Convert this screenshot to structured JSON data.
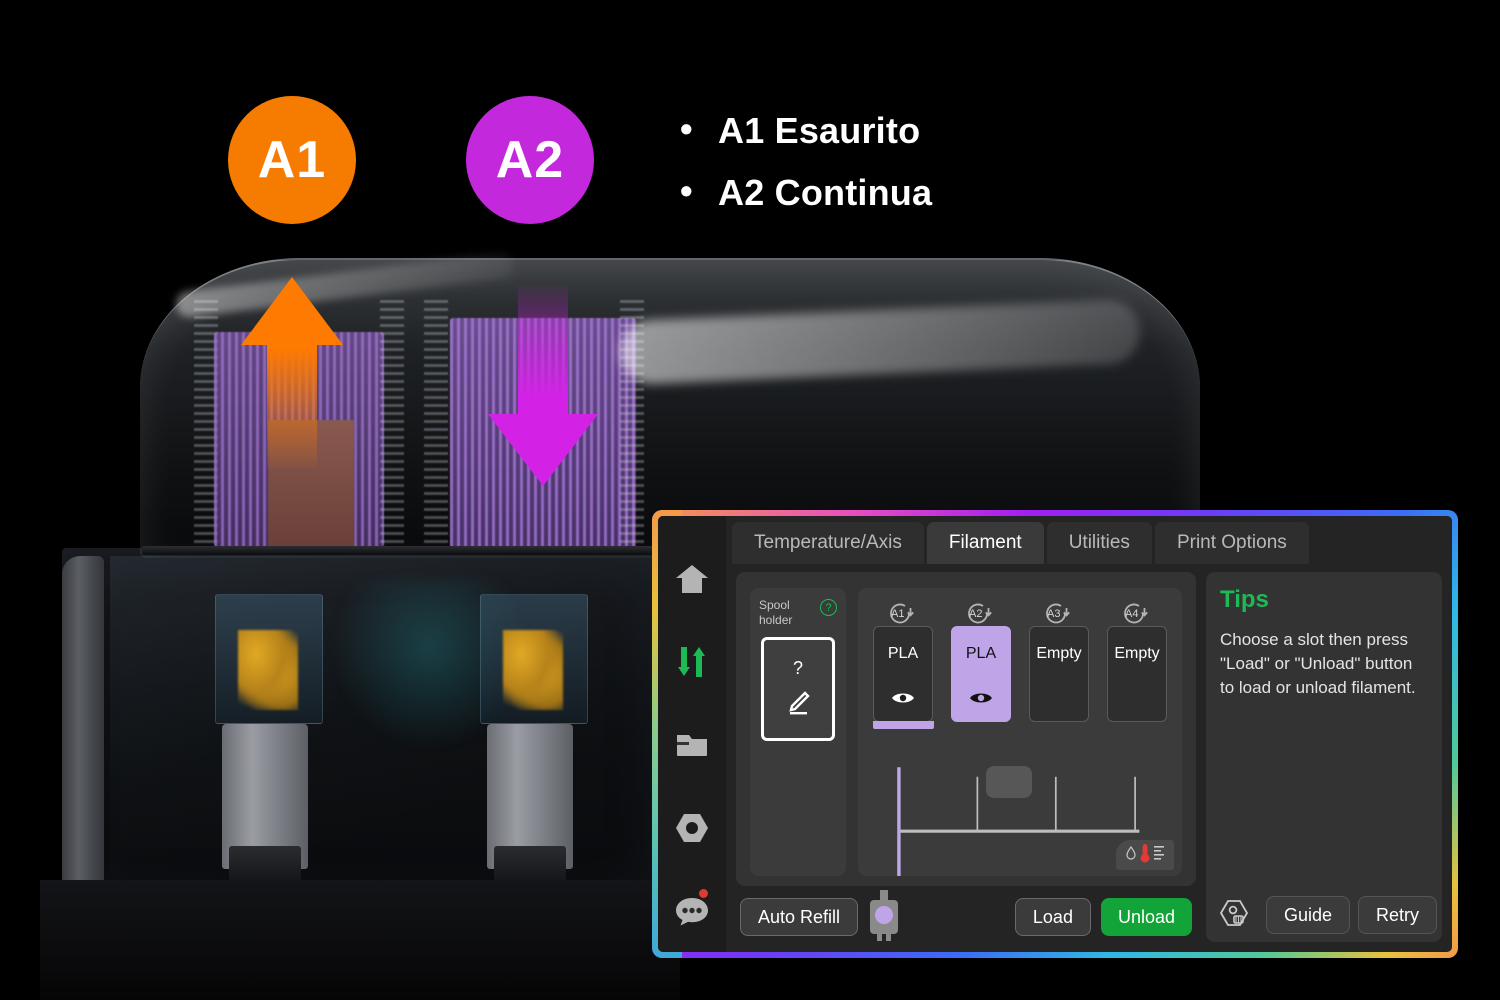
{
  "annotations": {
    "badges": [
      {
        "id": "A1",
        "label": "A1",
        "color": "#F57C00"
      },
      {
        "id": "A2",
        "label": "A2",
        "color": "#C428DC"
      }
    ],
    "callouts": [
      "A1 Esaurito",
      "A2 Continua"
    ],
    "arrows": [
      {
        "name": "a1-up-arrow",
        "direction": "up",
        "color": "#FF7A00"
      },
      {
        "name": "a2-down-arrow",
        "direction": "down",
        "color": "#D322E6"
      }
    ]
  },
  "ui": {
    "sidebar": [
      {
        "name": "home",
        "icon": "home-icon",
        "active": false
      },
      {
        "name": "filament",
        "icon": "filament-sliders-icon",
        "active": true,
        "color": "#1DB954"
      },
      {
        "name": "files",
        "icon": "folder-icon",
        "active": false
      },
      {
        "name": "nozzle",
        "icon": "hex-nut-icon",
        "active": false
      },
      {
        "name": "messages",
        "icon": "chat-bubble-icon",
        "active": false,
        "badge": true
      }
    ],
    "tabs": [
      {
        "label": "Temperature/Axis",
        "active": false
      },
      {
        "label": "Filament",
        "active": true
      },
      {
        "label": "Utilities",
        "active": false
      },
      {
        "label": "Print Options",
        "active": false
      }
    ],
    "spool_holder": {
      "label": "Spool\nholder",
      "help_glyph": "?",
      "slot_value": "?",
      "edit_icon": "pencil-icon",
      "selected": true
    },
    "slots": [
      {
        "tag": "A1",
        "material": "PLA",
        "state": "loaded",
        "color": "#2e2e2e",
        "eye": "eye-icon",
        "has_filament_line": true
      },
      {
        "tag": "A2",
        "material": "PLA",
        "state": "active",
        "color": "#BFA5E8",
        "eye": "eye-icon",
        "has_filament_line": false
      },
      {
        "tag": "A3",
        "material": "Empty",
        "state": "empty",
        "color": "#2e2e2e",
        "eye": "",
        "has_filament_line": false
      },
      {
        "tag": "A4",
        "material": "Empty",
        "state": "empty",
        "color": "#2e2e2e",
        "eye": "",
        "has_filament_line": false
      }
    ],
    "buttons": {
      "auto_refill": "Auto Refill",
      "load": "Load",
      "unload": "Unload",
      "guide": "Guide",
      "retry": "Retry"
    },
    "tips": {
      "title": "Tips",
      "body": "Choose a slot then press \"Load\" or \"Unload\" button to load or unload filament."
    },
    "colors": {
      "accent_green": "#12A438",
      "tips_green": "#1DB954",
      "active_slot": "#BFA5E8",
      "panel_bg": "#242424",
      "card_bg": "#333333"
    }
  }
}
